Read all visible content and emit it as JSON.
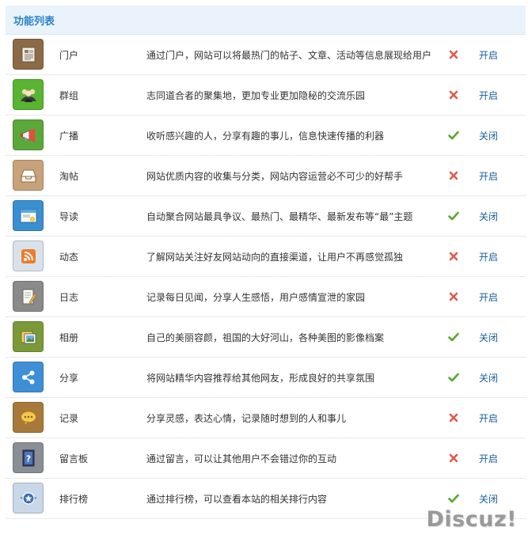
{
  "panel": {
    "title": "功能列表"
  },
  "rows": [
    {
      "id": "portal",
      "name": "门户",
      "desc": "通过门户，网站可以将最热门的帖子、文章、活动等信息展现给用户",
      "enabled": false,
      "action": "开启",
      "icon": "newspaper-icon",
      "color": "#8b6a45"
    },
    {
      "id": "group",
      "name": "群组",
      "desc": "志同道合者的聚集地，更加专业更加隐秘的交流乐园",
      "enabled": false,
      "action": "开启",
      "icon": "people-icon",
      "color": "#58b431"
    },
    {
      "id": "broadcast",
      "name": "广播",
      "desc": "收听感兴趣的人，分享有趣的事儿，信息快速传播的利器",
      "enabled": true,
      "action": "关闭",
      "icon": "megaphone-icon",
      "color": "#5aa83a"
    },
    {
      "id": "taotie",
      "name": "淘帖",
      "desc": "网站优质内容的收集与分类，网站内容运营必不可少的好帮手",
      "enabled": false,
      "action": "开启",
      "icon": "inbox-tray-icon",
      "color": "#c8a27a"
    },
    {
      "id": "guide",
      "name": "导读",
      "desc": "自动聚合网站最具争议、最热门、最精华、最新发布等“最”主题",
      "enabled": true,
      "action": "关闭",
      "icon": "window-info-icon",
      "color": "#3a8fd0"
    },
    {
      "id": "feed",
      "name": "动态",
      "desc": "了解网站关注好友网站动向的直接渠道，让用户不再感觉孤独",
      "enabled": false,
      "action": "开启",
      "icon": "rss-icon",
      "color": "#d9e2ea"
    },
    {
      "id": "blog",
      "name": "日志",
      "desc": "记录每日见闻，分享人生感悟，用户感情宣泄的家园",
      "enabled": false,
      "action": "开启",
      "icon": "notepad-pencil-icon",
      "color": "#8a8a8a"
    },
    {
      "id": "album",
      "name": "相册",
      "desc": "自己的美丽容颜，祖国的大好河山，各种美图的影像档案",
      "enabled": true,
      "action": "关闭",
      "icon": "photo-album-icon",
      "color": "#7a9a3a"
    },
    {
      "id": "share",
      "name": "分享",
      "desc": "将网站精华内容推荐给其他网友，形成良好的共享氛围",
      "enabled": true,
      "action": "关闭",
      "icon": "share-icon",
      "color": "#3f8fd6"
    },
    {
      "id": "doing",
      "name": "记录",
      "desc": "分享灵感，表达心情，记录随时想到的人和事儿",
      "enabled": false,
      "action": "开启",
      "icon": "speech-bubble-icon",
      "color": "#a8793a"
    },
    {
      "id": "wall",
      "name": "留言板",
      "desc": "通过留言，可以让其他用户不会错过你的互动",
      "enabled": false,
      "action": "开启",
      "icon": "question-board-icon",
      "color": "#8a8f96"
    },
    {
      "id": "ranklist",
      "name": "排行榜",
      "desc": "通过排行榜，可以查看本站的相关排行内容",
      "enabled": true,
      "action": "关闭",
      "icon": "star-badge-icon",
      "color": "#c9d8e8"
    }
  ],
  "colors": {
    "on": "#5aa830",
    "off": "#e05a4b",
    "link": "#1b5e9c"
  },
  "watermark": "Discuz!"
}
